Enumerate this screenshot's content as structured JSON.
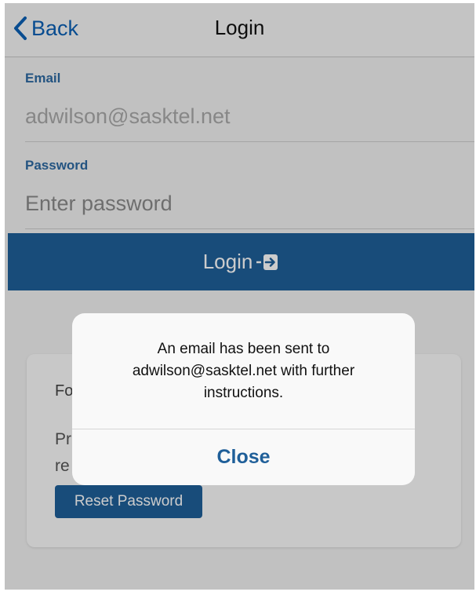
{
  "navbar": {
    "back_label": "Back",
    "title": "Login"
  },
  "form": {
    "email_label": "Email",
    "email_value": "adwilson@sasktel.net",
    "password_label": "Password",
    "password_placeholder": "Enter password",
    "login_label": "Login"
  },
  "forgot_card": {
    "title_partial": "Fo",
    "desc_partial": "Pr\nre",
    "reset_label": "Reset Password"
  },
  "alert": {
    "message": "An email has been sent to adwilson@sasktel.net with further instructions.",
    "close_label": "Close"
  },
  "icons": {
    "back": "chevron-left-icon",
    "login": "sign-in-icon"
  },
  "colors": {
    "accent": "#1f5f99",
    "link": "#0a5fb5",
    "label": "#2e6aa2"
  }
}
